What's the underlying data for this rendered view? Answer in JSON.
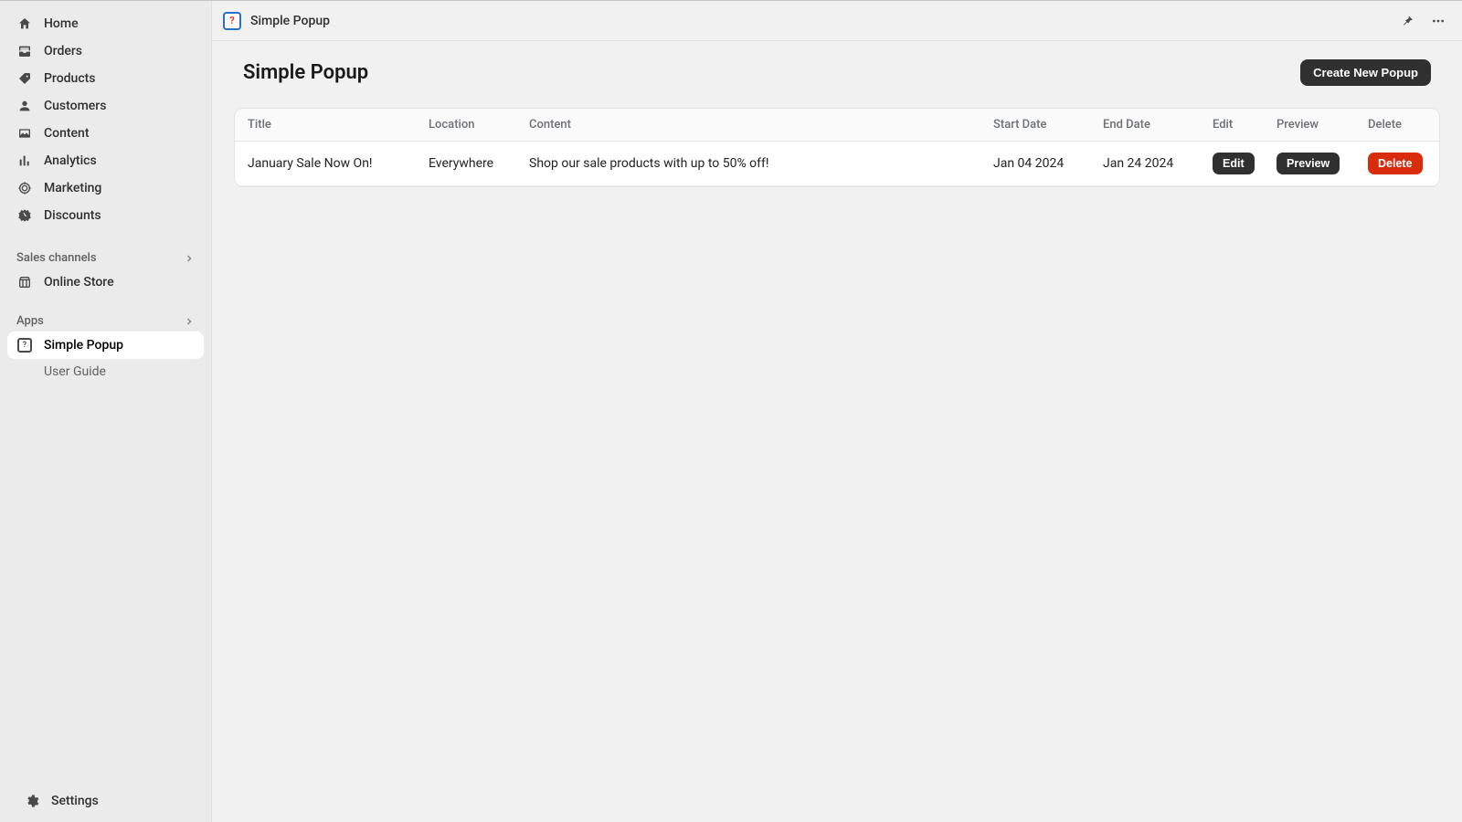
{
  "sidebar": {
    "nav": [
      {
        "label": "Home"
      },
      {
        "label": "Orders"
      },
      {
        "label": "Products"
      },
      {
        "label": "Customers"
      },
      {
        "label": "Content"
      },
      {
        "label": "Analytics"
      },
      {
        "label": "Marketing"
      },
      {
        "label": "Discounts"
      }
    ],
    "sales_channels_label": "Sales channels",
    "online_store_label": "Online Store",
    "apps_label": "Apps",
    "apps": [
      {
        "label": "Simple Popup"
      },
      {
        "label": "User Guide"
      }
    ],
    "settings_label": "Settings"
  },
  "topbar": {
    "app_name": "Simple Popup"
  },
  "page": {
    "title": "Simple Popup",
    "create_button": "Create New Popup"
  },
  "table": {
    "columns": {
      "title": "Title",
      "location": "Location",
      "content": "Content",
      "start_date": "Start Date",
      "end_date": "End Date",
      "edit": "Edit",
      "preview": "Preview",
      "delete": "Delete"
    },
    "rows": [
      {
        "title": "January Sale Now On!",
        "location": "Everywhere",
        "content": "Shop our sale products with up to 50% off!",
        "start_date": "Jan 04 2024",
        "end_date": "Jan 24 2024",
        "edit_label": "Edit",
        "preview_label": "Preview",
        "delete_label": "Delete"
      }
    ]
  }
}
